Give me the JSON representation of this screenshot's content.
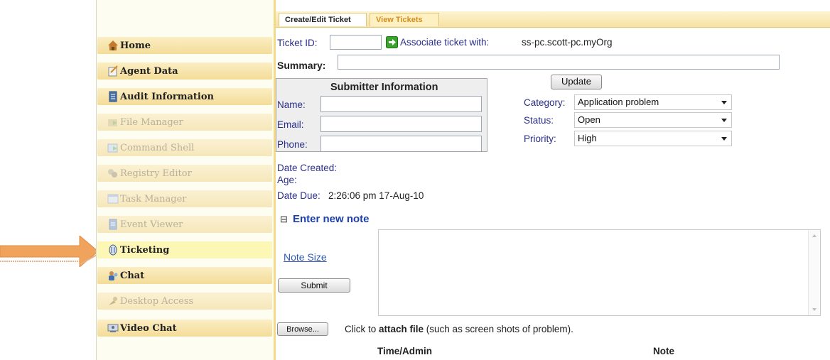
{
  "sidebar": {
    "items": [
      {
        "label": "Home",
        "icon": "home-icon",
        "enabled": true
      },
      {
        "label": "Agent Data",
        "icon": "agent-data-icon",
        "enabled": true
      },
      {
        "label": "Audit Information",
        "icon": "audit-icon",
        "enabled": true
      },
      {
        "label": "File Manager",
        "icon": "file-manager-icon",
        "enabled": false
      },
      {
        "label": "Command Shell",
        "icon": "command-shell-icon",
        "enabled": false
      },
      {
        "label": "Registry Editor",
        "icon": "registry-editor-icon",
        "enabled": false
      },
      {
        "label": "Task Manager",
        "icon": "task-manager-icon",
        "enabled": false
      },
      {
        "label": "Event Viewer",
        "icon": "event-viewer-icon",
        "enabled": false
      },
      {
        "label": "Ticketing",
        "icon": "ticketing-icon",
        "enabled": true,
        "active": true
      },
      {
        "label": "Chat",
        "icon": "chat-icon",
        "enabled": true
      },
      {
        "label": "Desktop Access",
        "icon": "desktop-access-icon",
        "enabled": false
      },
      {
        "label": "Video Chat",
        "icon": "video-chat-icon",
        "enabled": true
      }
    ]
  },
  "tabs": [
    {
      "label": "Create/Edit Ticket",
      "active": true
    },
    {
      "label": "View Tickets",
      "active": false
    }
  ],
  "ticket": {
    "id_label": "Ticket ID:",
    "id_value": "",
    "associate_label": "Associate ticket with:",
    "associate_value": "ss-pc.scott-pc.myOrg",
    "summary_label": "Summary:",
    "summary_value": ""
  },
  "submitter": {
    "title": "Submitter Information",
    "name_label": "Name:",
    "email_label": "Email:",
    "phone_label": "Phone:"
  },
  "update_label": "Update",
  "fields": {
    "category_label": "Category:",
    "category_value": "Application problem",
    "status_label": "Status:",
    "status_value": "Open",
    "priority_label": "Priority:",
    "priority_value": "High"
  },
  "dates": {
    "created_label": "Date Created:",
    "age_label": "Age:",
    "due_label": "Date Due:",
    "due_value": "2:26:06 pm 17-Aug-10"
  },
  "note": {
    "toggle": "⊟",
    "heading": "Enter new note",
    "size_link": "Note Size",
    "submit_label": "Submit"
  },
  "attach": {
    "browse_label": "Browse...",
    "prefix": "Click to ",
    "bold": "attach file",
    "suffix": " (such as screen shots of problem)."
  },
  "table_headers": [
    "Time/Admin",
    "Note"
  ],
  "colors": {
    "accent": "#f5d98a",
    "link": "#2a2f8a",
    "arrow": "#f0a35c",
    "tab_inactive_text": "#d98c1c"
  }
}
